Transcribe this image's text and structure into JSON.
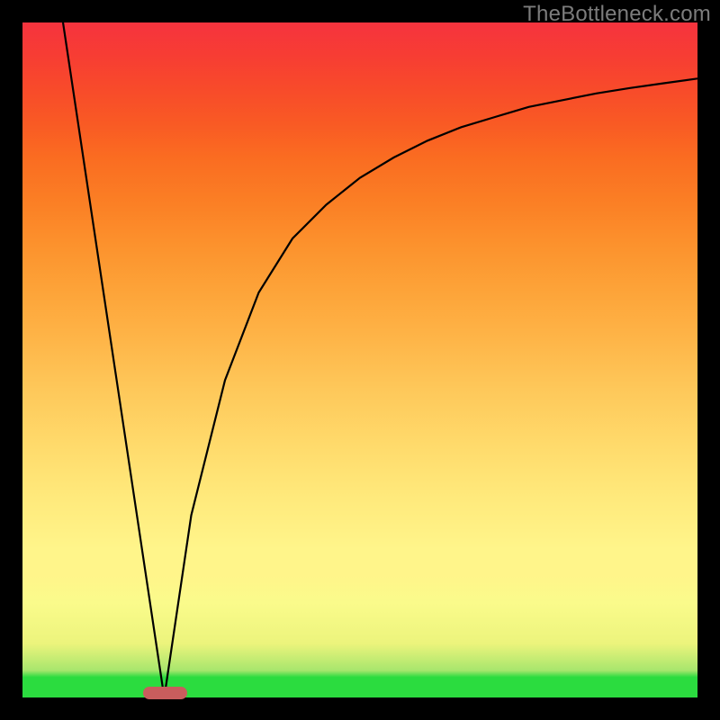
{
  "watermark": "TheBottleneck.com",
  "colors": {
    "page_bg": "#000000",
    "gradient_top": "#f6333e",
    "gradient_bottom": "#2bdc3f",
    "curve_stroke": "#000000",
    "marker_fill": "#c95d5d",
    "watermark_text": "#7c7c7c"
  },
  "plot": {
    "x_range": [
      0,
      100
    ],
    "y_range": [
      0,
      100
    ],
    "marker": {
      "x_start": 17.8,
      "x_end": 24.4,
      "y": 0.7
    }
  },
  "chart_data": {
    "type": "line",
    "title": "",
    "xlabel": "",
    "ylabel": "",
    "xlim": [
      0,
      100
    ],
    "ylim": [
      0,
      100
    ],
    "series": [
      {
        "name": "left-leg",
        "x": [
          6,
          21
        ],
        "values": [
          100,
          0
        ]
      },
      {
        "name": "right-curve",
        "x": [
          21,
          25,
          30,
          35,
          40,
          45,
          50,
          55,
          60,
          65,
          70,
          75,
          80,
          85,
          90,
          95,
          100
        ],
        "values": [
          0,
          27,
          47,
          60,
          68,
          73,
          77,
          80,
          82.5,
          84.5,
          86,
          87.5,
          88.5,
          89.5,
          90.3,
          91,
          91.7
        ]
      }
    ],
    "annotations": [
      {
        "type": "marker",
        "x_start": 17.8,
        "x_end": 24.4,
        "y": 0.7,
        "color": "#c95d5d"
      }
    ]
  }
}
